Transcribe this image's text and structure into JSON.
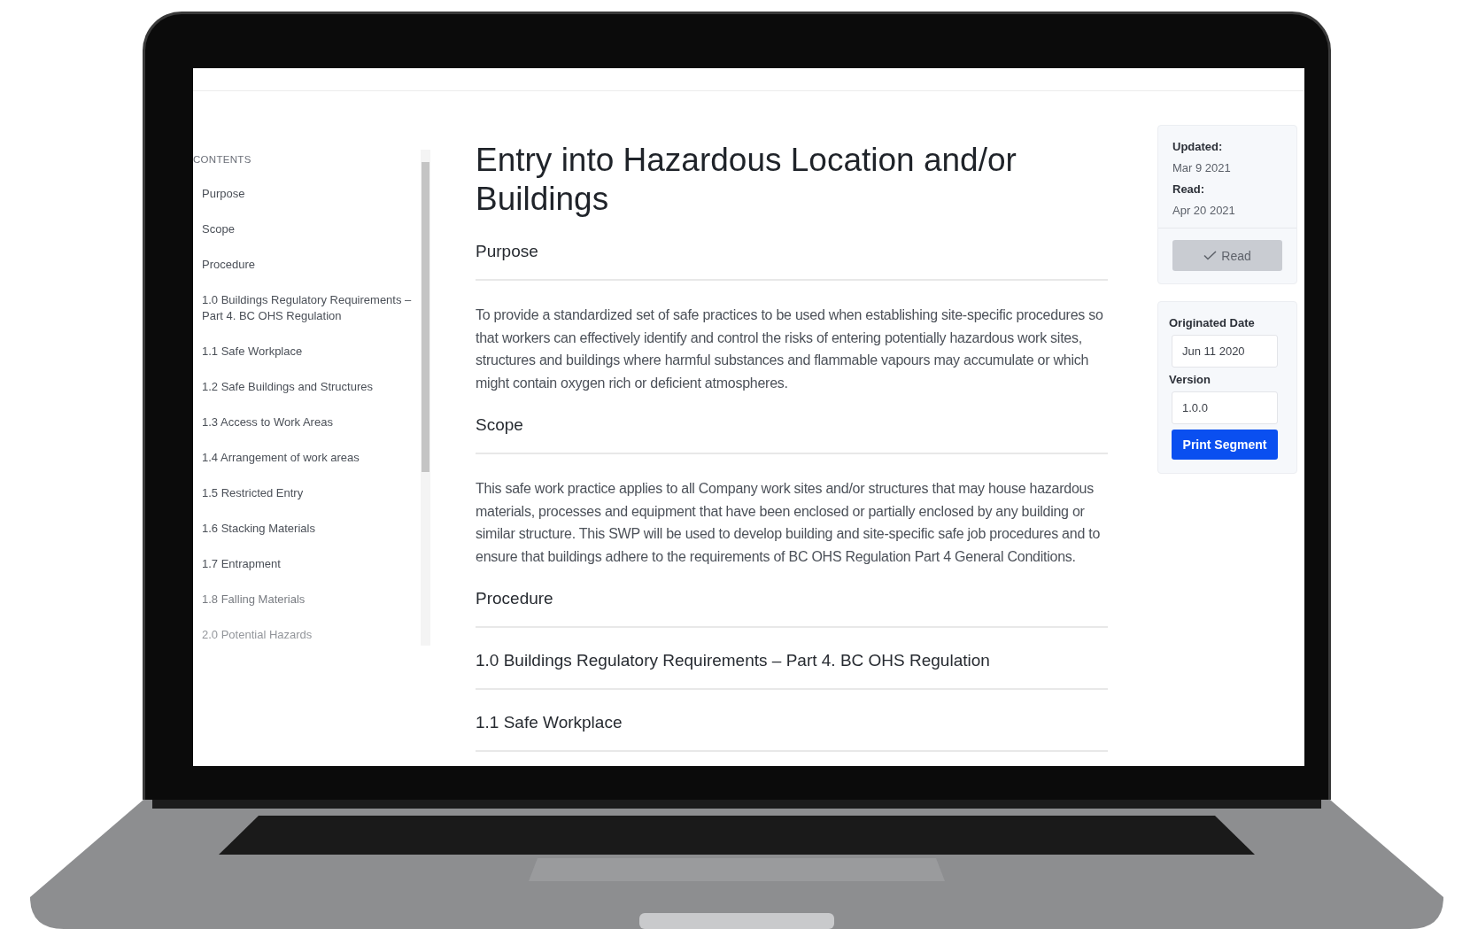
{
  "sidebar": {
    "heading": "CONTENTS",
    "items": [
      {
        "label": "Purpose"
      },
      {
        "label": "Scope"
      },
      {
        "label": "Procedure"
      },
      {
        "label": "1.0 Buildings Regulatory Requirements – Part 4. BC OHS Regulation"
      },
      {
        "label": "1.1 Safe Workplace"
      },
      {
        "label": "1.2 Safe Buildings and Structures"
      },
      {
        "label": "1.3 Access to Work Areas"
      },
      {
        "label": "1.4 Arrangement of work areas"
      },
      {
        "label": "1.5 Restricted Entry"
      },
      {
        "label": "1.6 Stacking Materials"
      },
      {
        "label": "1.7 Entrapment"
      },
      {
        "label": "1.8 Falling Materials"
      },
      {
        "label": "2.0 Potential Hazards"
      }
    ]
  },
  "document": {
    "title": "Entry into Hazardous Location and/or Buildings",
    "sections": [
      {
        "heading": "Purpose",
        "body": "To provide a standardized set of safe practices to be used when establishing site-specific procedures so that workers can effectively identify and control the risks of entering potentially hazardous work sites, structures and buildings where harmful substances and flammable vapours may accumulate or which might contain oxygen rich or deficient atmospheres."
      },
      {
        "heading": "Scope",
        "body": "This safe work practice applies to all Company work sites and/or structures that may house hazardous materials, processes and equipment that have been enclosed or partially enclosed by any building or similar structure. This SWP will be used to develop building and site-specific safe job procedures and to ensure that buildings adhere to the requirements of BC OHS Regulation Part 4 General Conditions."
      },
      {
        "heading": "Procedure"
      },
      {
        "heading": "1.0 Buildings Regulatory Requirements – Part 4. BC OHS Regulation"
      },
      {
        "heading": "1.1 Safe Workplace"
      }
    ]
  },
  "status_card": {
    "updated_label": "Updated:",
    "updated": "Mar 9 2021",
    "read_label": "Read:",
    "read": "Apr 20 2021",
    "read_button": {
      "label": "Read",
      "disabled": true
    }
  },
  "details_card": {
    "originated_label": "Originated Date",
    "originated": "Jun 11 2020",
    "version_label": "Version",
    "version": "1.0.0",
    "print_button": "Print Segment"
  }
}
